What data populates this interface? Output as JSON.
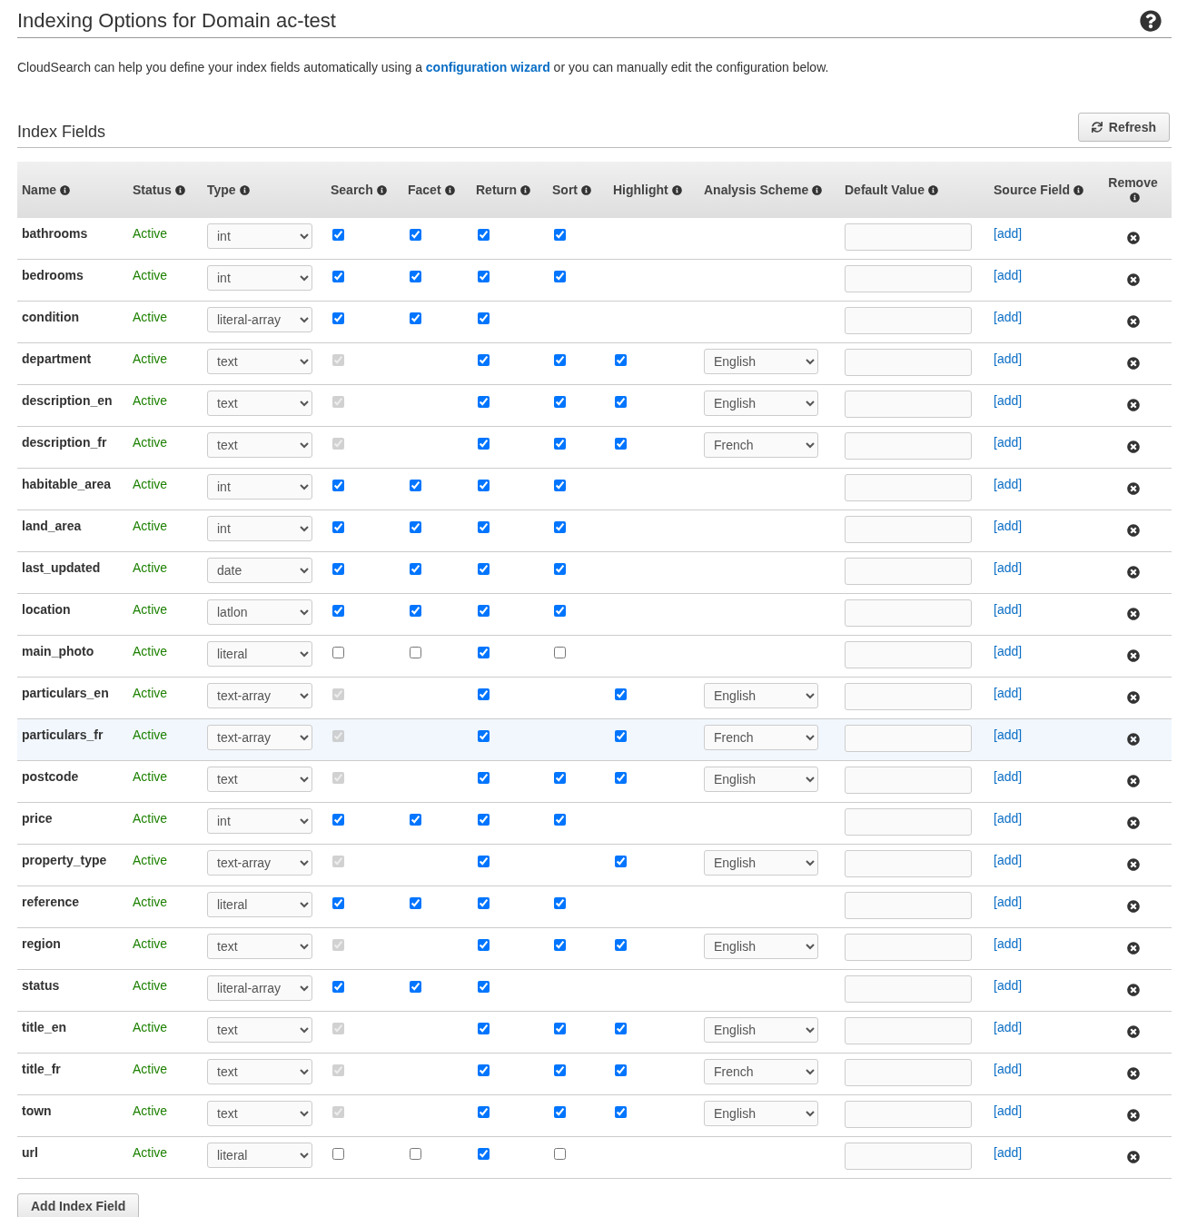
{
  "page_title": "Indexing Options for Domain ac-test",
  "intro": {
    "before": "CloudSearch can help you define your index fields automatically using a",
    "link": "configuration wizard",
    "after": "or you can manually edit the configuration below."
  },
  "section_title": "Index Fields",
  "refresh_button": "Refresh",
  "columns": [
    {
      "label": "Name"
    },
    {
      "label": "Status"
    },
    {
      "label": "Type"
    },
    {
      "label": "Search"
    },
    {
      "label": "Facet"
    },
    {
      "label": "Return"
    },
    {
      "label": "Sort"
    },
    {
      "label": "Highlight"
    },
    {
      "label": "Analysis Scheme"
    },
    {
      "label": "Default Value"
    },
    {
      "label": "Source Field"
    },
    {
      "label": "Remove"
    }
  ],
  "rows": [
    {
      "name": "bathrooms",
      "status": "Active",
      "type": "int",
      "search": {
        "checked": true,
        "disabled": false
      },
      "facet": {
        "checked": true,
        "disabled": false
      },
      "return": {
        "checked": true,
        "disabled": false
      },
      "sort": {
        "checked": true,
        "disabled": false
      },
      "source_field": "[add]"
    },
    {
      "name": "bedrooms",
      "status": "Active",
      "type": "int",
      "search": {
        "checked": true,
        "disabled": false
      },
      "facet": {
        "checked": true,
        "disabled": false
      },
      "return": {
        "checked": true,
        "disabled": false
      },
      "sort": {
        "checked": true,
        "disabled": false
      },
      "source_field": "[add]"
    },
    {
      "name": "condition",
      "status": "Active",
      "type": "literal-array",
      "search": {
        "checked": true,
        "disabled": false
      },
      "facet": {
        "checked": true,
        "disabled": false
      },
      "return": {
        "checked": true,
        "disabled": false
      },
      "source_field": "[add]"
    },
    {
      "name": "department",
      "status": "Active",
      "type": "text",
      "search": {
        "checked": true,
        "disabled": true
      },
      "return": {
        "checked": true,
        "disabled": false
      },
      "sort": {
        "checked": true,
        "disabled": false
      },
      "highlight": {
        "checked": true,
        "disabled": false
      },
      "analysis_scheme": "English",
      "source_field": "[add]"
    },
    {
      "name": "description_en",
      "status": "Active",
      "type": "text",
      "search": {
        "checked": true,
        "disabled": true
      },
      "return": {
        "checked": true,
        "disabled": false
      },
      "sort": {
        "checked": true,
        "disabled": false
      },
      "highlight": {
        "checked": true,
        "disabled": false
      },
      "analysis_scheme": "English",
      "source_field": "[add]"
    },
    {
      "name": "description_fr",
      "status": "Active",
      "type": "text",
      "search": {
        "checked": true,
        "disabled": true
      },
      "return": {
        "checked": true,
        "disabled": false
      },
      "sort": {
        "checked": true,
        "disabled": false
      },
      "highlight": {
        "checked": true,
        "disabled": false
      },
      "analysis_scheme": "French",
      "source_field": "[add]"
    },
    {
      "name": "habitable_area",
      "status": "Active",
      "type": "int",
      "search": {
        "checked": true,
        "disabled": false
      },
      "facet": {
        "checked": true,
        "disabled": false
      },
      "return": {
        "checked": true,
        "disabled": false
      },
      "sort": {
        "checked": true,
        "disabled": false
      },
      "source_field": "[add]"
    },
    {
      "name": "land_area",
      "status": "Active",
      "type": "int",
      "search": {
        "checked": true,
        "disabled": false
      },
      "facet": {
        "checked": true,
        "disabled": false
      },
      "return": {
        "checked": true,
        "disabled": false
      },
      "sort": {
        "checked": true,
        "disabled": false
      },
      "source_field": "[add]"
    },
    {
      "name": "last_updated",
      "status": "Active",
      "type": "date",
      "search": {
        "checked": true,
        "disabled": false
      },
      "facet": {
        "checked": true,
        "disabled": false
      },
      "return": {
        "checked": true,
        "disabled": false
      },
      "sort": {
        "checked": true,
        "disabled": false
      },
      "source_field": "[add]"
    },
    {
      "name": "location",
      "status": "Active",
      "type": "latlon",
      "search": {
        "checked": true,
        "disabled": false
      },
      "facet": {
        "checked": true,
        "disabled": false
      },
      "return": {
        "checked": true,
        "disabled": false
      },
      "sort": {
        "checked": true,
        "disabled": false
      },
      "source_field": "[add]"
    },
    {
      "name": "main_photo",
      "status": "Active",
      "type": "literal",
      "search": {
        "checked": false,
        "disabled": false
      },
      "facet": {
        "checked": false,
        "disabled": false
      },
      "return": {
        "checked": true,
        "disabled": false
      },
      "sort": {
        "checked": false,
        "disabled": false
      },
      "source_field": "[add]"
    },
    {
      "name": "particulars_en",
      "status": "Active",
      "type": "text-array",
      "search": {
        "checked": true,
        "disabled": true
      },
      "return": {
        "checked": true,
        "disabled": false
      },
      "highlight": {
        "checked": true,
        "disabled": false
      },
      "analysis_scheme": "English",
      "source_field": "[add]"
    },
    {
      "name": "particulars_fr",
      "status": "Active",
      "type": "text-array",
      "hovered": true,
      "search": {
        "checked": true,
        "disabled": true
      },
      "return": {
        "checked": true,
        "disabled": false
      },
      "highlight": {
        "checked": true,
        "disabled": false
      },
      "analysis_scheme": "French",
      "source_field": "[add]"
    },
    {
      "name": "postcode",
      "status": "Active",
      "type": "text",
      "search": {
        "checked": true,
        "disabled": true
      },
      "return": {
        "checked": true,
        "disabled": false
      },
      "sort": {
        "checked": true,
        "disabled": false
      },
      "highlight": {
        "checked": true,
        "disabled": false
      },
      "analysis_scheme": "English",
      "source_field": "[add]"
    },
    {
      "name": "price",
      "status": "Active",
      "type": "int",
      "search": {
        "checked": true,
        "disabled": false
      },
      "facet": {
        "checked": true,
        "disabled": false
      },
      "return": {
        "checked": true,
        "disabled": false
      },
      "sort": {
        "checked": true,
        "disabled": false
      },
      "source_field": "[add]"
    },
    {
      "name": "property_type",
      "status": "Active",
      "type": "text-array",
      "search": {
        "checked": true,
        "disabled": true
      },
      "return": {
        "checked": true,
        "disabled": false
      },
      "highlight": {
        "checked": true,
        "disabled": false
      },
      "analysis_scheme": "English",
      "source_field": "[add]"
    },
    {
      "name": "reference",
      "status": "Active",
      "type": "literal",
      "search": {
        "checked": true,
        "disabled": false
      },
      "facet": {
        "checked": true,
        "disabled": false
      },
      "return": {
        "checked": true,
        "disabled": false
      },
      "sort": {
        "checked": true,
        "disabled": false
      },
      "source_field": "[add]"
    },
    {
      "name": "region",
      "status": "Active",
      "type": "text",
      "search": {
        "checked": true,
        "disabled": true
      },
      "return": {
        "checked": true,
        "disabled": false
      },
      "sort": {
        "checked": true,
        "disabled": false
      },
      "highlight": {
        "checked": true,
        "disabled": false
      },
      "analysis_scheme": "English",
      "source_field": "[add]"
    },
    {
      "name": "status",
      "status": "Active",
      "type": "literal-array",
      "search": {
        "checked": true,
        "disabled": false
      },
      "facet": {
        "checked": true,
        "disabled": false
      },
      "return": {
        "checked": true,
        "disabled": false
      },
      "source_field": "[add]"
    },
    {
      "name": "title_en",
      "status": "Active",
      "type": "text",
      "search": {
        "checked": true,
        "disabled": true
      },
      "return": {
        "checked": true,
        "disabled": false
      },
      "sort": {
        "checked": true,
        "disabled": false
      },
      "highlight": {
        "checked": true,
        "disabled": false
      },
      "analysis_scheme": "English",
      "source_field": "[add]"
    },
    {
      "name": "title_fr",
      "status": "Active",
      "type": "text",
      "search": {
        "checked": true,
        "disabled": true
      },
      "return": {
        "checked": true,
        "disabled": false
      },
      "sort": {
        "checked": true,
        "disabled": false
      },
      "highlight": {
        "checked": true,
        "disabled": false
      },
      "analysis_scheme": "French",
      "source_field": "[add]"
    },
    {
      "name": "town",
      "status": "Active",
      "type": "text",
      "search": {
        "checked": true,
        "disabled": true
      },
      "return": {
        "checked": true,
        "disabled": false
      },
      "sort": {
        "checked": true,
        "disabled": false
      },
      "highlight": {
        "checked": true,
        "disabled": false
      },
      "analysis_scheme": "English",
      "source_field": "[add]"
    },
    {
      "name": "url",
      "status": "Active",
      "type": "literal",
      "search": {
        "checked": false,
        "disabled": false
      },
      "facet": {
        "checked": false,
        "disabled": false
      },
      "return": {
        "checked": true,
        "disabled": false
      },
      "sort": {
        "checked": false,
        "disabled": false
      },
      "source_field": "[add]"
    }
  ],
  "add_button": "Add Index Field"
}
